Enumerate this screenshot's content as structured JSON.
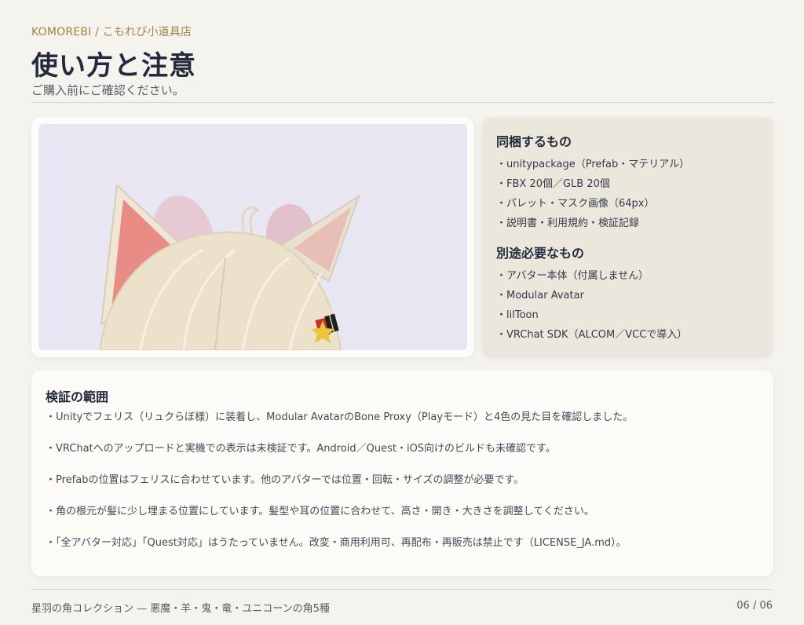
{
  "header": {
    "brand": "KOMOREBI / こもれび小道具店",
    "title": "使い方と注意",
    "subtitle": "ご購入前にご確認ください。"
  },
  "photo": {
    "background": "#e9e6f3"
  },
  "included": {
    "heading": "同梱するもの",
    "items": [
      "・unitypackage（Prefab・マテリアル）",
      "・FBX 20個／GLB 20個",
      "・パレット・マスク画像（64px）",
      "・説明書・利用規約・検証記録"
    ]
  },
  "required": {
    "heading": "別途必要なもの",
    "items": [
      "・アバター本体（付属しません）",
      "・Modular Avatar",
      "・lilToon",
      "・VRChat SDK（ALCOM／VCCで導入）"
    ]
  },
  "scope": {
    "heading": "検証の範囲",
    "paragraphs": [
      "・Unityでフェリス（リュクらぼ様）に装着し、Modular AvatarのBone Proxy（Playモード）と4色の見た目を確認しました。",
      "・VRChatへのアップロードと実機での表示は未検証です。Android／Quest・iOS向けのビルドも未確認です。",
      "・Prefabの位置はフェリスに合わせています。他のアバターでは位置・回転・サイズの調整が必要です。",
      "・角の根元が髪に少し埋まる位置にしています。髪型や耳の位置に合わせて、高さ・開き・大きさを調整してください。",
      "・「全アバター対応」「Quest対応」はうたっていません。改変・商用利用可、再配布・再販売は禁止です（LICENSE_JA.md）。"
    ]
  },
  "footer": {
    "left": "星羽の角コレクション — 悪魔・羊・鬼・竜・ユニコーンの角5種",
    "right": "06 / 06"
  },
  "colors": {
    "accent": "#a08445",
    "page_bg": "#f5f3ee",
    "info_card_bg": "#ebe7dc"
  }
}
